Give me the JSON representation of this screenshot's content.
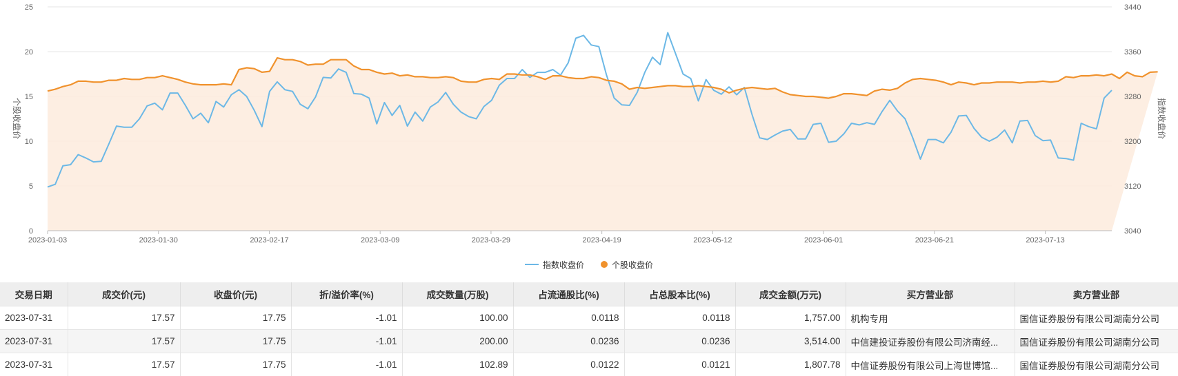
{
  "chart_data": {
    "type": "line",
    "x_ticks": [
      "2023-01-03",
      "2023-01-30",
      "2023-02-17",
      "2023-03-09",
      "2023-03-29",
      "2023-04-19",
      "2023-05-12",
      "2023-06-01",
      "2023-06-21",
      "2023-07-13"
    ],
    "y_left": {
      "label": "个股收盘价",
      "ticks": [
        "0",
        "5",
        "10",
        "15",
        "20",
        "25"
      ],
      "range": [
        0,
        25
      ]
    },
    "y_right": {
      "label": "指数收盘价",
      "ticks": [
        "3040",
        "3120",
        "3200",
        "3280",
        "3360",
        "3440"
      ],
      "range": [
        3040,
        3440
      ]
    },
    "legend_position": "bottom",
    "series": [
      {
        "name": "指数收盘价",
        "axis": "right",
        "color": "#6cb8e6",
        "values": [
          3118,
          3123,
          3156,
          3158,
          3176,
          3170,
          3163,
          3164,
          3195,
          3227,
          3225,
          3225,
          3240,
          3263,
          3268,
          3256,
          3286,
          3286,
          3264,
          3240,
          3250,
          3233,
          3271,
          3261,
          3283,
          3292,
          3280,
          3255,
          3226,
          3289,
          3306,
          3292,
          3289,
          3266,
          3258,
          3279,
          3314,
          3313,
          3329,
          3323,
          3285,
          3284,
          3277,
          3231,
          3269,
          3246,
          3264,
          3227,
          3252,
          3236,
          3261,
          3270,
          3287,
          3266,
          3252,
          3244,
          3240,
          3262,
          3273,
          3300,
          3312,
          3312,
          3328,
          3314,
          3323,
          3323,
          3328,
          3318,
          3340,
          3384,
          3389,
          3372,
          3369,
          3318,
          3277,
          3265,
          3264,
          3287,
          3323,
          3350,
          3337,
          3394,
          3357,
          3320,
          3312,
          3272,
          3310,
          3291,
          3284,
          3297,
          3283,
          3296,
          3248,
          3206,
          3203,
          3211,
          3218,
          3221,
          3204,
          3204,
          3230,
          3232,
          3198,
          3200,
          3213,
          3232,
          3229,
          3233,
          3230,
          3253,
          3273,
          3254,
          3240,
          3206,
          3168,
          3203,
          3203,
          3197,
          3216,
          3245,
          3246,
          3223,
          3207,
          3200,
          3207,
          3220,
          3197,
          3236,
          3237,
          3210,
          3201,
          3202,
          3170,
          3169,
          3166,
          3232,
          3226,
          3222,
          3277,
          3291
        ]
      },
      {
        "name": "个股收盘价",
        "axis": "left",
        "color": "#f0922d",
        "values": [
          15.6,
          15.8,
          16.1,
          16.3,
          16.7,
          16.7,
          16.6,
          16.6,
          16.8,
          16.8,
          17.0,
          16.9,
          16.9,
          17.1,
          17.1,
          17.3,
          17.1,
          16.9,
          16.6,
          16.4,
          16.3,
          16.3,
          16.3,
          16.4,
          16.3,
          18.0,
          18.2,
          18.1,
          17.7,
          17.8,
          19.3,
          19.1,
          19.1,
          18.9,
          18.5,
          18.6,
          18.6,
          19.1,
          19.1,
          19.1,
          18.4,
          18.0,
          18.0,
          17.7,
          17.5,
          17.6,
          17.3,
          17.4,
          17.2,
          17.2,
          17.1,
          17.1,
          17.2,
          17.1,
          16.7,
          16.6,
          16.6,
          16.9,
          17.0,
          16.9,
          17.5,
          17.5,
          17.4,
          17.4,
          17.2,
          16.9,
          17.3,
          17.3,
          17.1,
          17.0,
          17.0,
          17.2,
          17.1,
          16.8,
          16.7,
          16.4,
          15.8,
          16.0,
          15.9,
          16.0,
          16.1,
          16.2,
          16.2,
          16.1,
          16.1,
          16.2,
          16.1,
          16.0,
          15.8,
          15.4,
          15.7,
          15.9,
          16.0,
          15.9,
          15.8,
          15.9,
          15.5,
          15.2,
          15.1,
          15.0,
          15.0,
          14.9,
          14.8,
          15.0,
          15.3,
          15.3,
          15.2,
          15.1,
          15.6,
          15.8,
          15.7,
          15.9,
          16.5,
          16.9,
          17.0,
          16.9,
          16.8,
          16.6,
          16.3,
          16.6,
          16.5,
          16.3,
          16.5,
          16.5,
          16.6,
          16.6,
          16.6,
          16.5,
          16.6,
          16.6,
          16.7,
          16.6,
          16.7,
          17.2,
          17.1,
          17.3,
          17.3,
          17.4,
          17.3,
          17.5,
          17.0,
          17.7,
          17.3,
          17.2,
          17.7,
          17.75
        ]
      }
    ]
  },
  "legend": {
    "index_label": "指数收盘价",
    "stock_label": "个股收盘价"
  },
  "table": {
    "headers": [
      "交易日期",
      "成交价(元)",
      "收盘价(元)",
      "折/溢价率(%)",
      "成交数量(万股)",
      "占流通股比(%)",
      "占总股本比(%)",
      "成交金额(万元)",
      "买方营业部",
      "卖方营业部"
    ],
    "rows": [
      [
        "2023-07-31",
        "17.57",
        "17.75",
        "-1.01",
        "100.00",
        "0.0118",
        "0.0118",
        "1,757.00",
        "机构专用",
        "国信证券股份有限公司湖南分公司"
      ],
      [
        "2023-07-31",
        "17.57",
        "17.75",
        "-1.01",
        "200.00",
        "0.0236",
        "0.0236",
        "3,514.00",
        "中信建投证券股份有限公司济南经...",
        "国信证券股份有限公司湖南分公司"
      ],
      [
        "2023-07-31",
        "17.57",
        "17.75",
        "-1.01",
        "102.89",
        "0.0122",
        "0.0121",
        "1,807.78",
        "中信证券股份有限公司上海世博馆...",
        "国信证券股份有限公司湖南分公司"
      ]
    ]
  }
}
